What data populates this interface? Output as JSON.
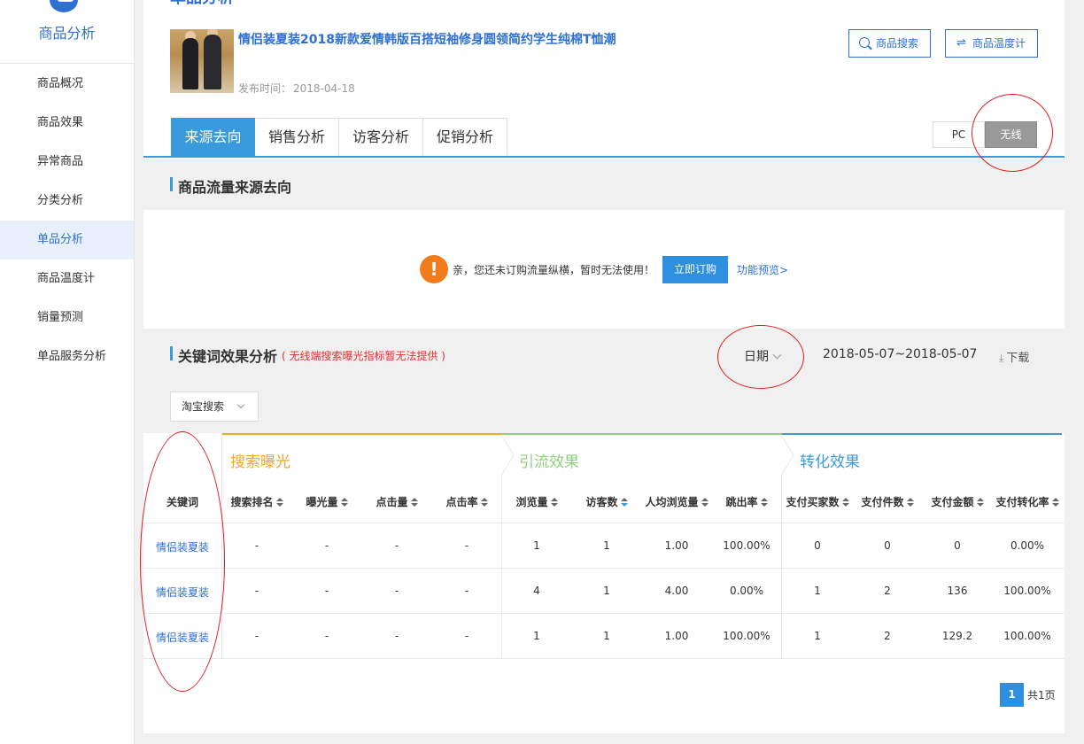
{
  "sidebar": {
    "title": "商品分析",
    "items": [
      {
        "label": "商品概况",
        "active": false
      },
      {
        "label": "商品效果",
        "active": false
      },
      {
        "label": "异常商品",
        "active": false
      },
      {
        "label": "分类分析",
        "active": false
      },
      {
        "label": "单品分析",
        "active": true
      },
      {
        "label": "商品温度计",
        "active": false
      },
      {
        "label": "销量预测",
        "active": false
      },
      {
        "label": "单品服务分析",
        "active": false
      }
    ]
  },
  "header": {
    "page_title": "单品分析",
    "product_name": "情侣装夏装2018新款爱情韩版百搭短袖修身圆领简约学生纯棉T恤潮",
    "publish_label": "发布时间：",
    "publish_date": "2018-04-18",
    "btn_search": "商品搜索",
    "btn_temp": "商品温度计"
  },
  "tabs": [
    "来源去向",
    "销售分析",
    "访客分析",
    "促销分析"
  ],
  "device": {
    "pc": "PC",
    "wireless": "无线",
    "selected": "无线"
  },
  "traffic_section": {
    "title": "商品流量来源去向",
    "notice": "亲，您还未订购流量纵横，暂时无法使用！",
    "order_btn": "立即订购",
    "preview_link": "功能预览>"
  },
  "keyword_section": {
    "title": "关键词效果分析",
    "subtitle": "( 无线端搜索曝光指标暂无法提供 )",
    "date_label": "日期",
    "date_range": "2018-05-07~2018-05-07",
    "download": "下载",
    "filter": "淘宝搜索"
  },
  "table": {
    "groups": [
      "搜索曝光",
      "引流效果",
      "转化效果"
    ],
    "columns": [
      "关键词",
      "搜索排名",
      "曝光量",
      "点击量",
      "点击率",
      "浏览量",
      "访客数",
      "人均浏览量",
      "跳出率",
      "支付买家数",
      "支付件数",
      "支付金额",
      "支付转化率"
    ],
    "rows": [
      [
        "情侣装夏装",
        "-",
        "-",
        "-",
        "-",
        "1",
        "1",
        "1.00",
        "100.00%",
        "0",
        "0",
        "0",
        "0.00%"
      ],
      [
        "情侣装夏装",
        "-",
        "-",
        "-",
        "-",
        "4",
        "1",
        "4.00",
        "0.00%",
        "1",
        "2",
        "136",
        "100.00%"
      ],
      [
        "情侣装夏装",
        "-",
        "-",
        "-",
        "-",
        "1",
        "1",
        "1.00",
        "100.00%",
        "1",
        "2",
        "129.2",
        "100.00%"
      ]
    ]
  },
  "pager": {
    "current": "1",
    "total": "共1页"
  },
  "colors": {
    "accent": "#3a9bdc",
    "brand": "#2d6fd2",
    "exposure": "#f5a623",
    "traffic": "#8fd07a",
    "conversion": "#3a9bdc",
    "annotation": "#e01b1b",
    "warning": "#f07c1c"
  }
}
